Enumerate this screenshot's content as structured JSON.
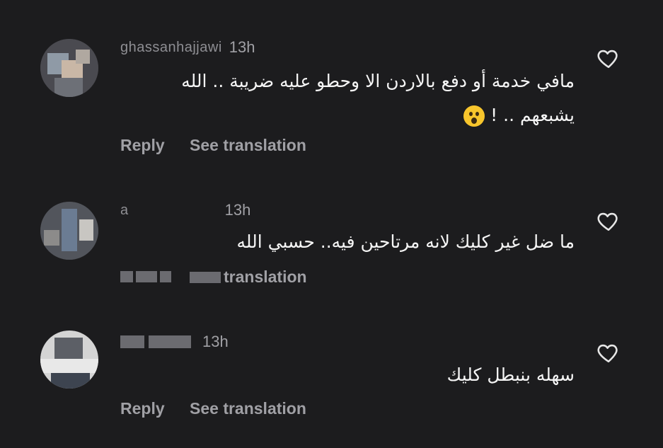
{
  "comments": [
    {
      "username": "ghassanhajjawi",
      "time": "13h",
      "text": "مافي خدمة أو دفع بالاردن الا وحطو عليه ضريبة .. الله يشبعهم .. !",
      "reply_label": "Reply",
      "translation_label": "See translation",
      "emoji": "hushed-face"
    },
    {
      "username": "a",
      "time": "13h",
      "text": "ما ضل غير كليك لانه مرتاحين فيه.. حسبي الله",
      "reply_label": "Reply",
      "translation_label": "translation"
    },
    {
      "username": "",
      "time": "13h",
      "text": "سهله بنبطل كليك",
      "reply_label": "Reply",
      "translation_label": "See translation"
    }
  ],
  "icons": {
    "like": "heart-outline-icon"
  },
  "colors": {
    "background": "#1c1c1e",
    "text": "#f5f5f5",
    "muted": "#a0a0a5"
  }
}
